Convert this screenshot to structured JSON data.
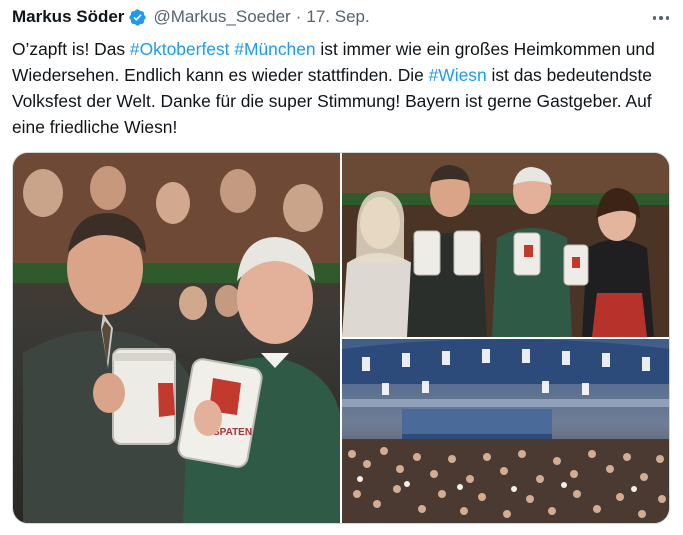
{
  "tweet": {
    "author_name": "Markus Söder",
    "handle": "@Markus_Soeder",
    "separator": "·",
    "date": "17. Sep.",
    "text_segments": [
      {
        "text": "O’zapft is! Das ",
        "type": "plain"
      },
      {
        "text": "#Oktoberfest",
        "type": "hashtag"
      },
      {
        "text": " ",
        "type": "plain"
      },
      {
        "text": "#München",
        "type": "hashtag"
      },
      {
        "text": " ist immer wie ein großes Heimkommen und Wiedersehen. Endlich kann es wieder stattfinden. Die ",
        "type": "plain"
      },
      {
        "text": "#Wiesn",
        "type": "hashtag"
      },
      {
        "text": " ist das bedeutendste Volksfest der Welt. Danke für die super Stimmung! Bayern ist gerne Gastgeber. Auf eine friedliche Wiesn!",
        "type": "plain"
      }
    ]
  },
  "media": {
    "mug_brand": "SPATEN",
    "photos": [
      {
        "name": "two-men-toasting-beer-mugs"
      },
      {
        "name": "group-toasting-beer-mugs"
      },
      {
        "name": "beer-tent-crowd"
      }
    ]
  },
  "colors": {
    "text": "#0f1419",
    "secondary": "#536471",
    "link": "#1d9bf0",
    "verified": "#1d9bf0"
  },
  "icons": [
    "verified-badge-icon",
    "more-options-icon"
  ]
}
